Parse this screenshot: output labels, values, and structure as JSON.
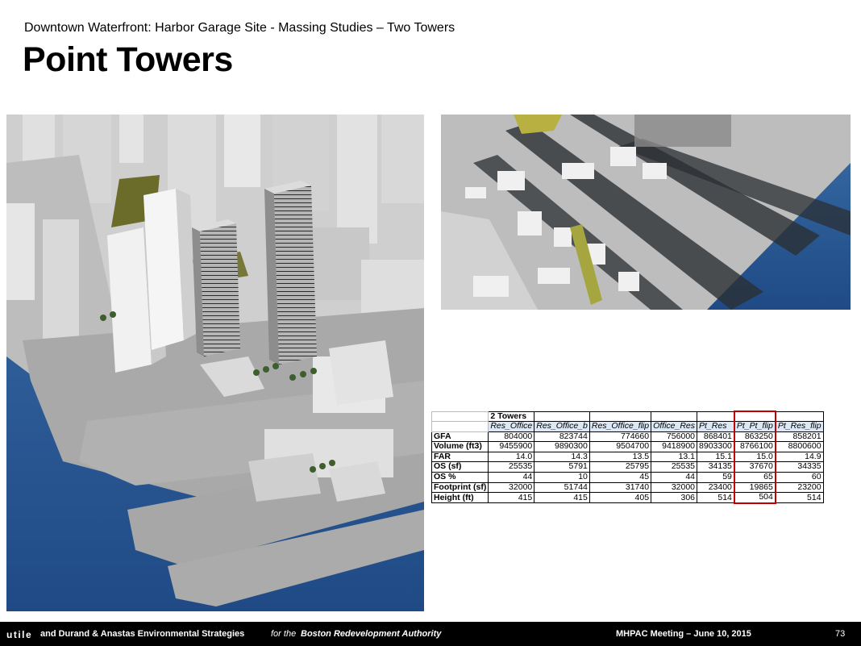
{
  "header": {
    "subtitle": "Downtown Waterfront: Harbor Garage Site - Massing Studies – Two Towers",
    "title": "Point Towers"
  },
  "table": {
    "group_label": "2 Towers",
    "columns": [
      "Res_Office",
      "Res_Office_b",
      "Res_Office_flip",
      "Office_Res",
      "Pt_Res",
      "Pt_Pt_flip",
      "Pt_Res_flip"
    ],
    "highlight_column": 5,
    "rows": [
      {
        "label": "GFA",
        "values": [
          "804000",
          "823744",
          "774660",
          "756000",
          "868401",
          "863250",
          "858201"
        ]
      },
      {
        "label": "Volume (ft3)",
        "values": [
          "9455900",
          "9890300",
          "9504700",
          "9418900",
          "8903300",
          "8766100",
          "8800600"
        ]
      },
      {
        "label": "FAR",
        "values": [
          "14.0",
          "14.3",
          "13.5",
          "13.1",
          "15.1",
          "15.0",
          "14.9"
        ]
      },
      {
        "label": "OS (sf)",
        "values": [
          "25535",
          "5791",
          "25795",
          "25535",
          "34135",
          "37670",
          "34335"
        ]
      },
      {
        "label": "OS %",
        "values": [
          "44",
          "10",
          "45",
          "44",
          "59",
          "65",
          "60"
        ]
      },
      {
        "label": "Footprint (sf)",
        "values": [
          "32000",
          "51744",
          "31740",
          "32000",
          "23400",
          "19865",
          "23200"
        ]
      },
      {
        "label": "Height (ft)",
        "values": [
          "415",
          "415",
          "405",
          "306",
          "514",
          "504",
          "514"
        ]
      }
    ]
  },
  "footer": {
    "brand": "utile",
    "partners": "and Durand & Anastas Environmental Strategies",
    "for_text": "for the",
    "authority": "Boston Redevelopment Authority",
    "meeting": "MHPAC Meeting  – June 10, 2015",
    "page": "73"
  },
  "colors": {
    "highlight_border": "#c00000",
    "table_header_bg": "#dce8f6",
    "footer_bg": "#000000"
  }
}
